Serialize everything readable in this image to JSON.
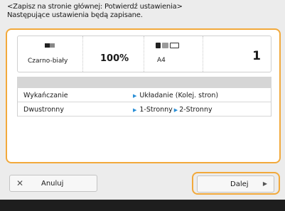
{
  "header": {
    "line1": "<Zapisz na stronie głównej: Potwierdź ustawienia>",
    "line2": "Następujące ustawienia będą zapisane."
  },
  "summary": {
    "color_mode": "Czarno-biały",
    "zoom": "100%",
    "paper": "A4",
    "copies": "1"
  },
  "settings": [
    {
      "label": "Wykańczanie",
      "value": "Układanie (Kolej. stron)"
    },
    {
      "label": "Dwustronny",
      "value_from": "1-Stronny",
      "value_to": "2-Stronny"
    }
  ],
  "buttons": {
    "cancel": "Anuluj",
    "next": "Dalej"
  },
  "colors": {
    "highlight": "#f2a93b",
    "arrow": "#2a8fd6"
  }
}
